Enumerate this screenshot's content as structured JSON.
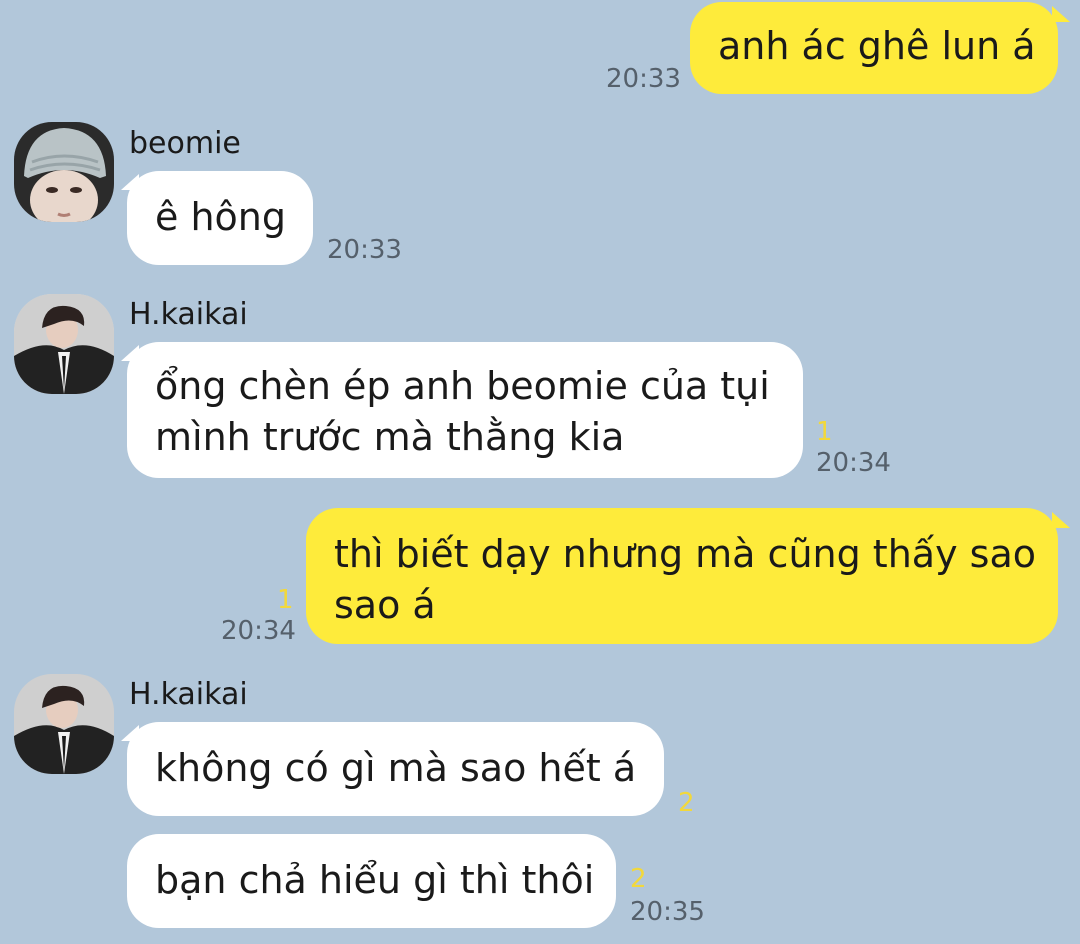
{
  "messages": [
    {
      "direction": "out",
      "text": "anh ác ghê lun á",
      "time": "20:33"
    },
    {
      "direction": "in",
      "sender": "beomie",
      "text": "ê hông",
      "time": "20:33"
    },
    {
      "direction": "in",
      "sender": "H.kaikai",
      "lines": [
        "ổng chèn ép anh beomie của tụi",
        "mình trước mà thằng kia"
      ],
      "unread": "1",
      "time": "20:34"
    },
    {
      "direction": "out",
      "lines": [
        "thì biết dạy nhưng mà cũng thấy sao",
        "sao á"
      ],
      "unread": "1",
      "time": "20:34"
    },
    {
      "direction": "in",
      "sender": "H.kaikai",
      "text": "không có gì mà sao hết á",
      "unread": "2"
    },
    {
      "direction": "in",
      "text": "bạn chả hiểu gì thì thôi",
      "unread": "2",
      "time": "20:35"
    }
  ],
  "colors": {
    "background": "#B2C7DA",
    "incoming_bubble": "#FFFFFF",
    "outgoing_bubble": "#FEEB3B",
    "unread_count": "#F2D83B",
    "timestamp": "#55606b"
  },
  "icons": {
    "avatar_beomie": "avatar-photo-person-in-beanie",
    "avatar_kaikai": "avatar-photo-person-in-suit"
  }
}
